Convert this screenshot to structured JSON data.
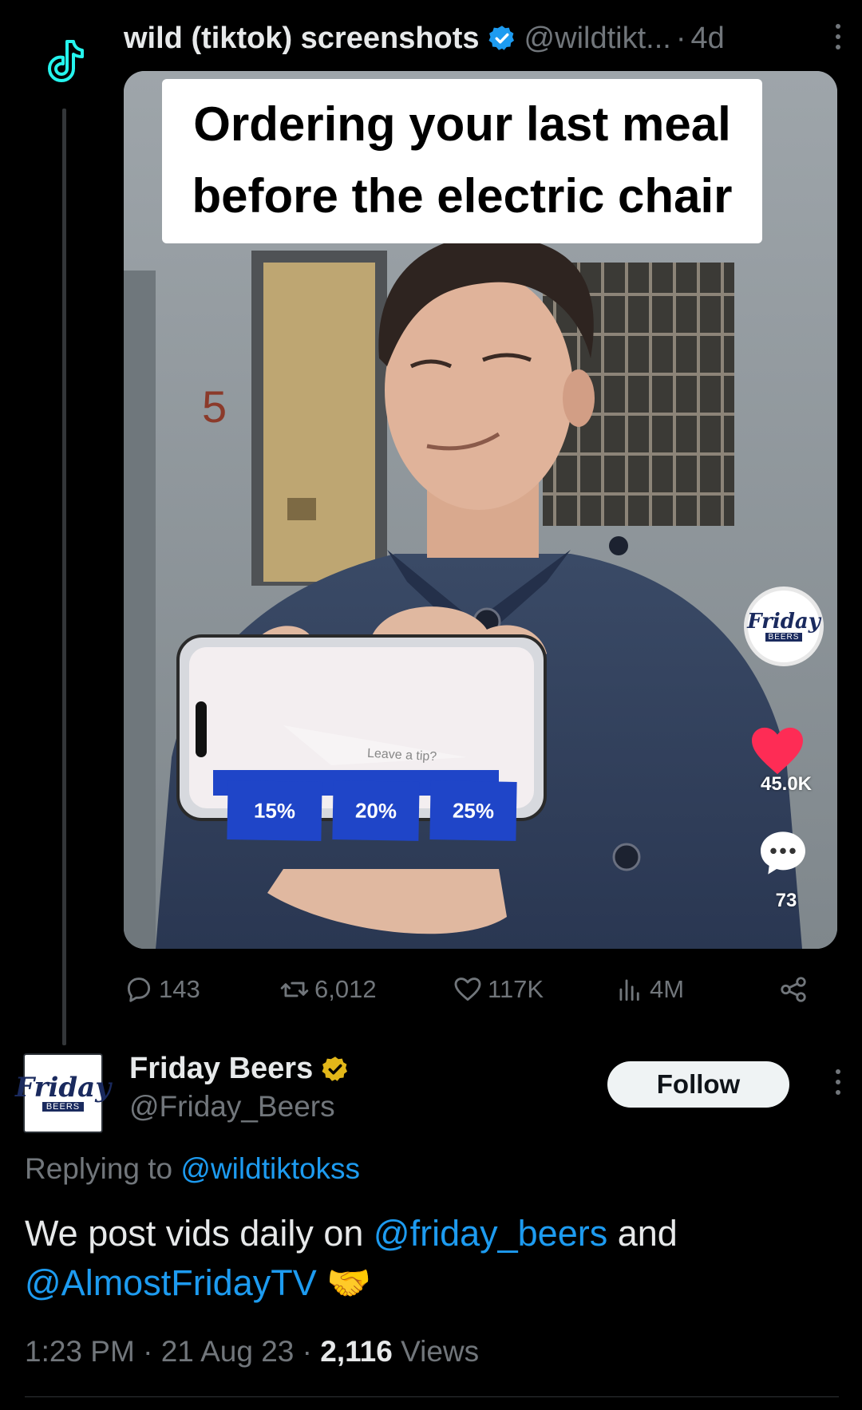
{
  "tweet": {
    "author_name": "wild (tiktok) screenshots",
    "author_handle": "@wildtikt...",
    "time": "4d",
    "caption_line1": "Ordering your last meal",
    "caption_line2": "before the electric chair",
    "video": {
      "room_number": "5",
      "tip_prompt": "Leave a tip?",
      "tip_options": [
        "15%",
        "20%",
        "25%"
      ],
      "brand_line1": "Friday",
      "brand_line2": "BEERS",
      "likes": "45.0K",
      "comments": "73"
    },
    "stats": {
      "replies": "143",
      "reposts": "6,012",
      "likes": "117K",
      "views": "4M"
    }
  },
  "reply": {
    "author_name": "Friday Beers",
    "author_handle": "@Friday_Beers",
    "avatar_line1": "Friday",
    "avatar_line2": "BEERS",
    "follow_label": "Follow",
    "replying_prefix": "Replying to",
    "replying_to": "@wildtiktokss",
    "text_1": "We post vids daily on",
    "mention_1": "@friday_beers",
    "text_2": "and",
    "mention_2": "@AlmostFridayTV",
    "emoji": "🤝",
    "time": "1:23 PM",
    "date": "21 Aug 23",
    "views_count": "2,116",
    "views_label": "Views"
  },
  "colors": {
    "background": "#000000",
    "text_primary": "#e7e9ea",
    "text_secondary": "#71767b",
    "link": "#1d9bf0",
    "verified_blue": "#1d9bf0",
    "verified_gold": "#e2b719",
    "tiktok_cyan": "#25f4ee"
  }
}
